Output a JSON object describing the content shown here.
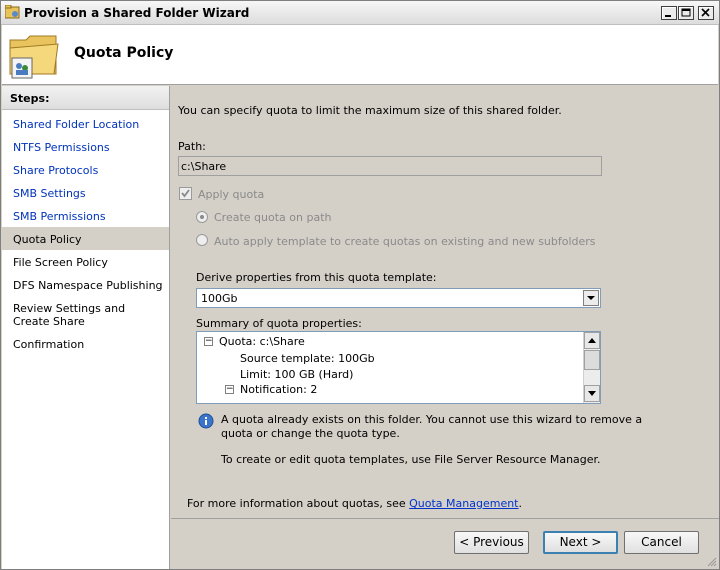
{
  "window": {
    "title": "Provision a Shared Folder Wizard",
    "icon": "folder-wizard-icon"
  },
  "header": {
    "title": "Quota Policy",
    "icon": "shared-folder-icon"
  },
  "sidebar": {
    "heading": "Steps:",
    "items": [
      {
        "label": "Shared Folder Location"
      },
      {
        "label": "NTFS Permissions"
      },
      {
        "label": "Share Protocols"
      },
      {
        "label": "SMB Settings"
      },
      {
        "label": "SMB Permissions"
      },
      {
        "label": "Quota Policy"
      },
      {
        "label": "File Screen Policy"
      },
      {
        "label": "DFS Namespace Publishing"
      },
      {
        "label": "Review Settings and Create Share"
      },
      {
        "label": "Confirmation"
      }
    ]
  },
  "main": {
    "intro": "You can specify quota to limit the maximum size of this shared folder.",
    "path_label": "Path:",
    "path_value": "c:\\Share",
    "apply_quota_label": "Apply quota",
    "radio_create_label": "Create quota on path",
    "radio_auto_label": "Auto apply template to create quotas on existing and new subfolders",
    "template_label": "Derive properties from this quota template:",
    "template_value": "100Gb",
    "summary_label": "Summary of quota properties:",
    "tree": [
      {
        "text": "Quota: c:\\Share"
      },
      {
        "text": "Source template: 100Gb"
      },
      {
        "text": "Limit: 100 GB (Hard)"
      },
      {
        "text": "Notification: 2"
      }
    ],
    "info_line1": "A quota already exists on this folder. You cannot use this wizard to remove a",
    "info_line2": "quota or change the quota type.",
    "info_line3": "To create or edit quota templates, use File Server Resource Manager.",
    "more_info_prefix": "For more information about quotas, see ",
    "more_info_link": "Quota Management",
    "more_info_suffix": "."
  },
  "footer": {
    "previous_label": "< Previous",
    "next_label": "Next >",
    "cancel_label": "Cancel"
  }
}
